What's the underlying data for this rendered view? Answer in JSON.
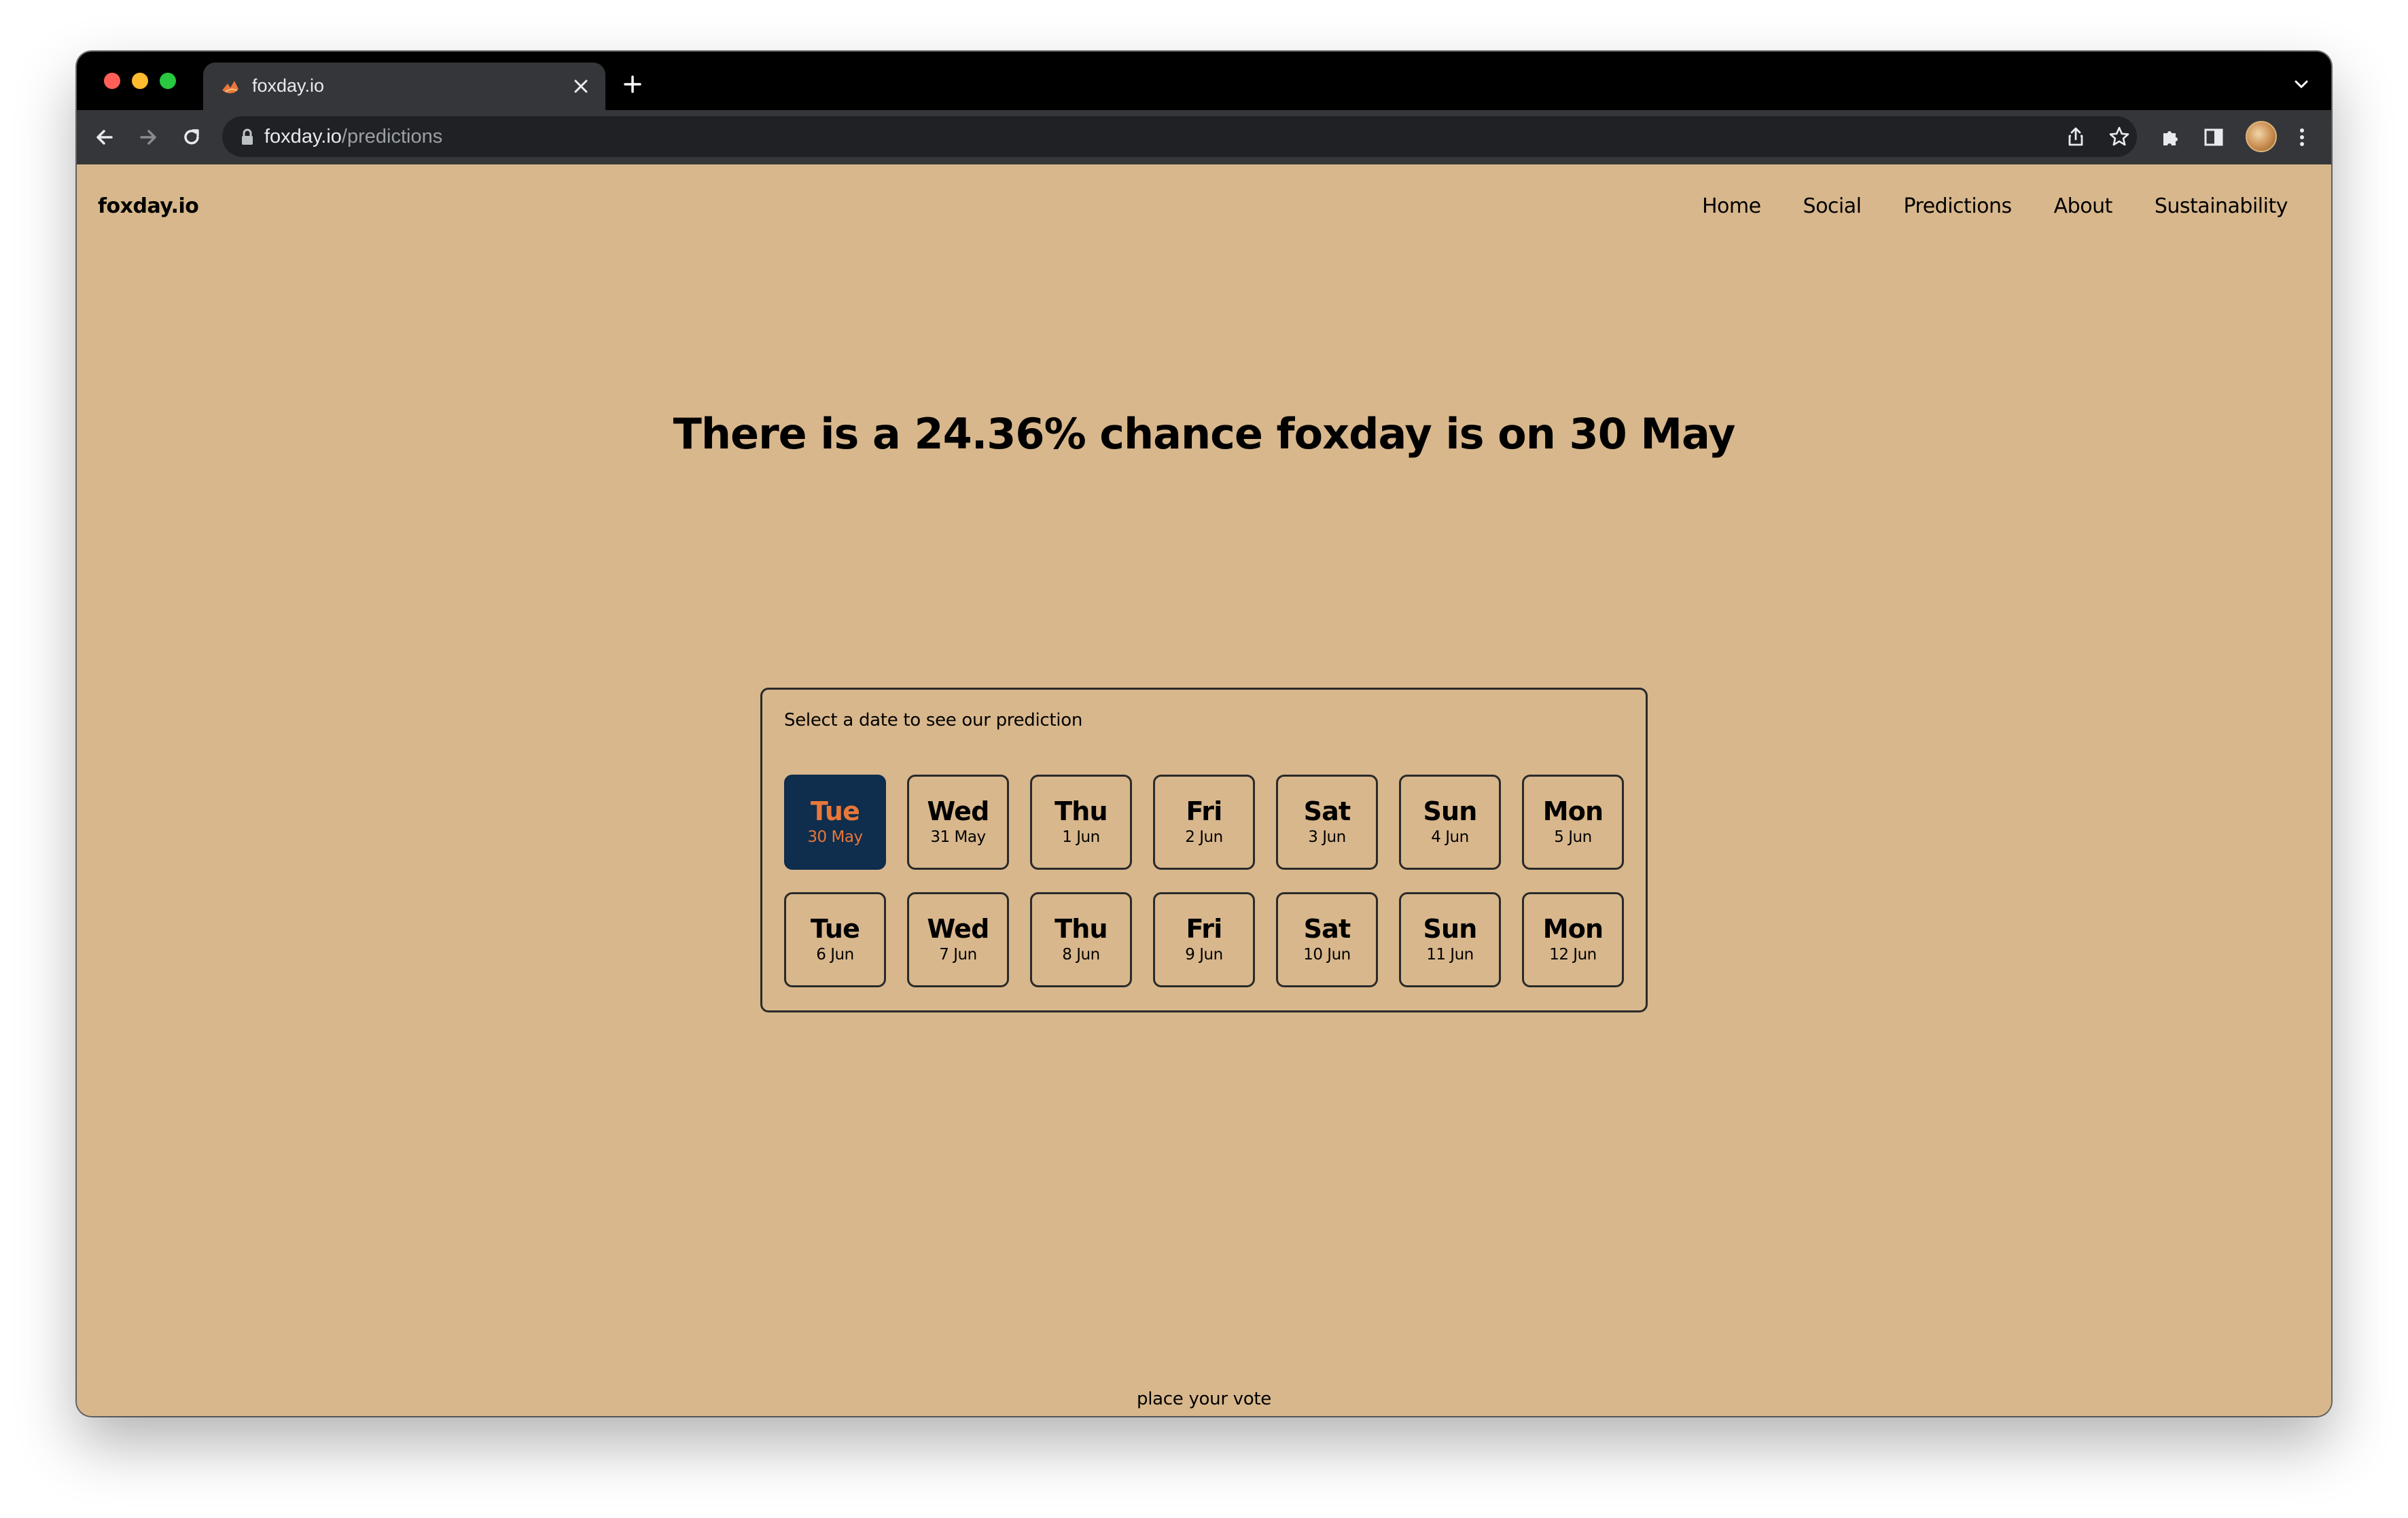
{
  "browser": {
    "tab_title": "foxday.io",
    "url_host": "foxday.io",
    "url_path": "/predictions"
  },
  "site": {
    "brand": "foxday.io",
    "nav": [
      "Home",
      "Social",
      "Predictions",
      "About",
      "Sustainability"
    ]
  },
  "headline": "There is a 24.36% chance foxday is on 30 May",
  "picker": {
    "label": "Select a date to see our prediction",
    "selected_index": 0,
    "selected_color": "#0f2d4c",
    "selected_text_color": "#e8773a",
    "dates": [
      {
        "dow": "Tue",
        "date": "30 May"
      },
      {
        "dow": "Wed",
        "date": "31 May"
      },
      {
        "dow": "Thu",
        "date": "1 Jun"
      },
      {
        "dow": "Fri",
        "date": "2 Jun"
      },
      {
        "dow": "Sat",
        "date": "3 Jun"
      },
      {
        "dow": "Sun",
        "date": "4 Jun"
      },
      {
        "dow": "Mon",
        "date": "5 Jun"
      },
      {
        "dow": "Tue",
        "date": "6 Jun"
      },
      {
        "dow": "Wed",
        "date": "7 Jun"
      },
      {
        "dow": "Thu",
        "date": "8 Jun"
      },
      {
        "dow": "Fri",
        "date": "9 Jun"
      },
      {
        "dow": "Sat",
        "date": "10 Jun"
      },
      {
        "dow": "Sun",
        "date": "11 Jun"
      },
      {
        "dow": "Mon",
        "date": "12 Jun"
      }
    ]
  },
  "vote": {
    "label": "place your vote",
    "icon": "triangle-down-icon"
  },
  "colors": {
    "page_background": "#d8b78c",
    "text": "#000000"
  }
}
